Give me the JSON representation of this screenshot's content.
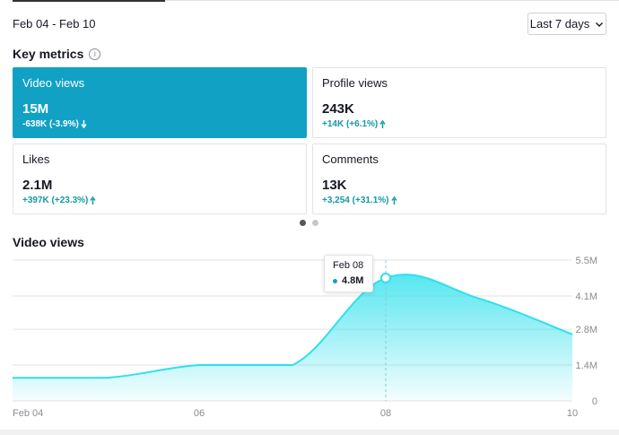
{
  "header": {
    "date_range": "Feb 04 - Feb 10",
    "period_label": "Last 7 days"
  },
  "key_metrics": {
    "title": "Key metrics",
    "cards": [
      {
        "label": "Video views",
        "value": "15M",
        "delta": "-638K (-3.9%)",
        "direction": "down",
        "active": true
      },
      {
        "label": "Profile views",
        "value": "243K",
        "delta": "+14K (+6.1%)",
        "direction": "up",
        "active": false
      },
      {
        "label": "Likes",
        "value": "2.1M",
        "delta": "+397K (+23.3%)",
        "direction": "up",
        "active": false
      },
      {
        "label": "Comments",
        "value": "13K",
        "delta": "+3,254 (+31.1%)",
        "direction": "up",
        "active": false
      }
    ]
  },
  "colors": {
    "accent": "#11a1c5",
    "line": "#2ee0ec",
    "positive": "#129aa4"
  },
  "chart_section": {
    "title": "Video views"
  },
  "tooltip": {
    "date": "Feb 08",
    "value": "4.8M"
  },
  "chart_data": {
    "type": "area",
    "title": "Video views",
    "x": [
      "Feb 04",
      "Feb 05",
      "Feb 06",
      "Feb 07",
      "Feb 08",
      "Feb 09",
      "Feb 10"
    ],
    "values": [
      0.9,
      0.9,
      1.4,
      1.4,
      4.8,
      4.0,
      2.6
    ],
    "x_tick_labels": [
      "Feb 04",
      "06",
      "08",
      "10"
    ],
    "y_tick_labels": [
      "0",
      "1.4M",
      "2.8M",
      "4.1M",
      "5.5M"
    ],
    "ylim": [
      0,
      5.5
    ],
    "y_unit": "M",
    "grid": true,
    "highlight_index": 4
  }
}
